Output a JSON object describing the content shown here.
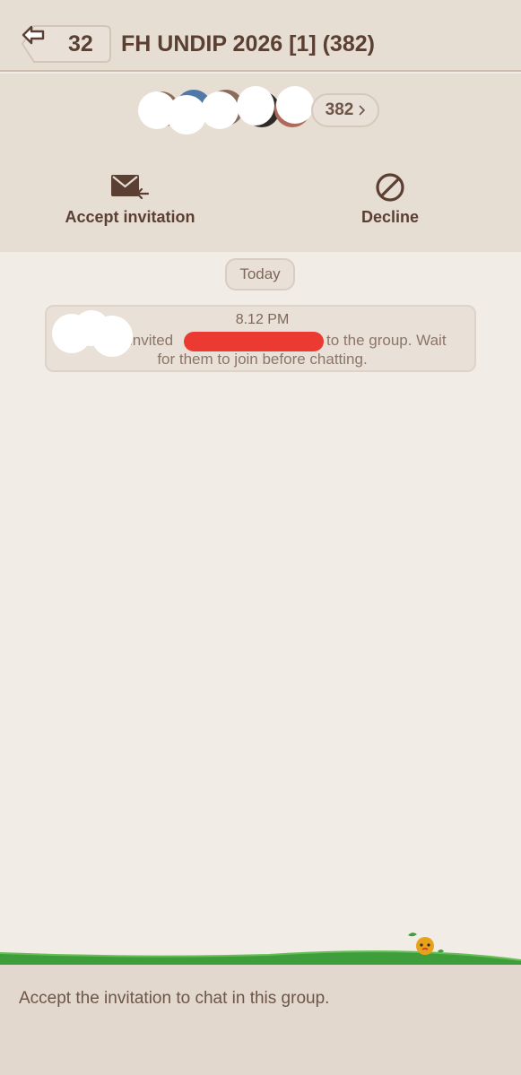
{
  "header": {
    "back_count": "32",
    "title": "FH UNDIP 2026 [1] (382)"
  },
  "members": {
    "count_label": "382"
  },
  "actions": {
    "accept_label": "Accept invitation",
    "decline_label": "Decline"
  },
  "chat": {
    "date_label": "Today",
    "system_message": {
      "time": "8.12 PM",
      "before_redaction": "invited",
      "after_redaction": "to the group. Wait",
      "line2": "for them to join before chatting."
    }
  },
  "footer": {
    "notice": "Accept the invitation to chat in this group."
  },
  "colors": {
    "header_bg": "#e6ddd3",
    "chat_bg": "#f1ece6",
    "text_brown": "#5b3f33",
    "grass_green": "#3f9e3c",
    "redaction_red": "#ea3a31"
  },
  "icons": {
    "back": "back-arrow-icon",
    "accept": "envelope-arrow-icon",
    "decline": "prohibited-icon",
    "members": "chevron-right-icon",
    "mascot": "mascot-icon"
  }
}
